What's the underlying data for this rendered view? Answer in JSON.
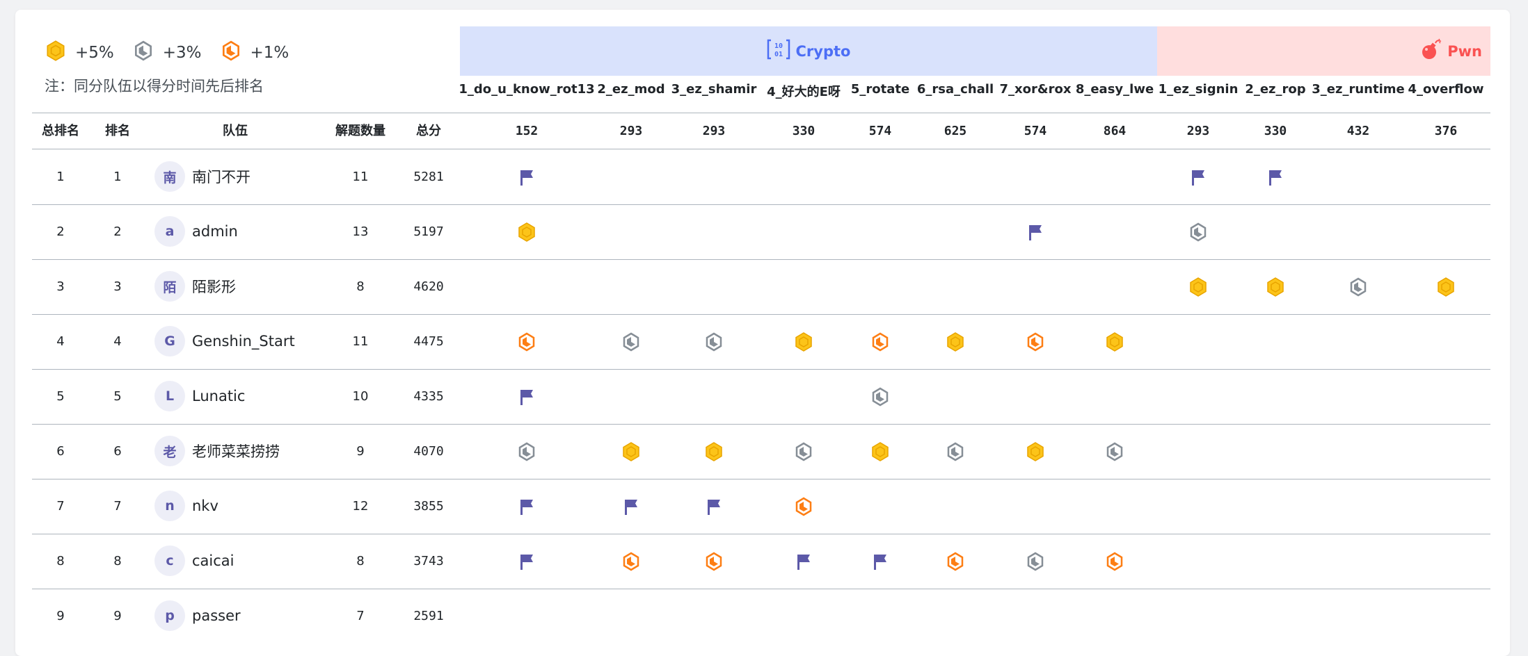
{
  "legend": [
    {
      "kind": "gold",
      "label": "+5%"
    },
    {
      "kind": "silver",
      "label": "+3%"
    },
    {
      "kind": "bronze",
      "label": "+1%"
    }
  ],
  "note": "注：同分队伍以得分时间先后排名",
  "categories": [
    {
      "name": "Crypto",
      "icon": "binary-icon",
      "color": "#4c6ef5",
      "bg": "#d9e2fc"
    },
    {
      "name": "Pwn",
      "icon": "bomb-icon",
      "color": "#fa5252",
      "bg": "#ffdede"
    }
  ],
  "columns": {
    "overall_rank": "总排名",
    "rank": "排名",
    "team": "队伍",
    "solved": "解题数量",
    "score": "总分"
  },
  "challenges": [
    {
      "name": "1_do_u_know_rot13",
      "score": "152"
    },
    {
      "name": "2_ez_mod",
      "score": "293"
    },
    {
      "name": "3_ez_shamir",
      "score": "293"
    },
    {
      "name": "4_好大的E呀",
      "score": "330"
    },
    {
      "name": "5_rotate",
      "score": "574"
    },
    {
      "name": "6_rsa_chall",
      "score": "625"
    },
    {
      "name": "7_xor&rox",
      "score": "574"
    },
    {
      "name": "8_easy_lwe",
      "score": "864"
    },
    {
      "name": "1_ez_signin",
      "score": "293"
    },
    {
      "name": "2_ez_rop",
      "score": "330"
    },
    {
      "name": "3_ez_runtime",
      "score": "432"
    },
    {
      "name": "4_overflow",
      "score": "376"
    }
  ],
  "rows": [
    {
      "overall": "1",
      "rank": "1",
      "avatar": "南",
      "team": "南门不开",
      "solved": "11",
      "score": "5281",
      "marks": [
        "flag",
        "",
        "",
        "",
        "",
        "",
        "",
        "",
        "flag",
        "flag",
        "",
        ""
      ]
    },
    {
      "overall": "2",
      "rank": "2",
      "avatar": "a",
      "team": "admin",
      "solved": "13",
      "score": "5197",
      "marks": [
        "gold",
        "",
        "",
        "",
        "",
        "",
        "flag",
        "",
        "silver",
        "",
        "",
        ""
      ]
    },
    {
      "overall": "3",
      "rank": "3",
      "avatar": "陌",
      "team": "陌影形",
      "solved": "8",
      "score": "4620",
      "marks": [
        "",
        "",
        "",
        "",
        "",
        "",
        "",
        "",
        "gold",
        "gold",
        "silver",
        "gold"
      ]
    },
    {
      "overall": "4",
      "rank": "4",
      "avatar": "G",
      "team": "Genshin_Start",
      "solved": "11",
      "score": "4475",
      "marks": [
        "bronze",
        "silver",
        "silver",
        "gold",
        "bronze",
        "gold",
        "bronze",
        "gold",
        "",
        "",
        "",
        ""
      ]
    },
    {
      "overall": "5",
      "rank": "5",
      "avatar": "L",
      "team": "Lunatic",
      "solved": "10",
      "score": "4335",
      "marks": [
        "flag",
        "",
        "",
        "",
        "silver",
        "",
        "",
        "",
        "",
        "",
        "",
        ""
      ]
    },
    {
      "overall": "6",
      "rank": "6",
      "avatar": "老",
      "team": "老师菜菜捞捞",
      "solved": "9",
      "score": "4070",
      "marks": [
        "silver",
        "gold",
        "gold",
        "silver",
        "gold",
        "silver",
        "gold",
        "silver",
        "",
        "",
        "",
        ""
      ]
    },
    {
      "overall": "7",
      "rank": "7",
      "avatar": "n",
      "team": "nkv",
      "solved": "12",
      "score": "3855",
      "marks": [
        "flag",
        "flag",
        "flag",
        "bronze",
        "",
        "",
        "",
        "",
        "",
        "",
        "",
        ""
      ]
    },
    {
      "overall": "8",
      "rank": "8",
      "avatar": "c",
      "team": "caicai",
      "solved": "8",
      "score": "3743",
      "marks": [
        "flag",
        "bronze",
        "bronze",
        "flag",
        "flag",
        "bronze",
        "silver",
        "bronze",
        "",
        "",
        "",
        ""
      ]
    },
    {
      "overall": "9",
      "rank": "9",
      "avatar": "p",
      "team": "passer",
      "solved": "7",
      "score": "2591",
      "marks": [
        "",
        "",
        "",
        "",
        "",
        "",
        "",
        "",
        "",
        "",
        "",
        ""
      ]
    }
  ],
  "colors": {
    "gold": "#fcc419",
    "gold_border": "#e8a400",
    "silver": "#adb5bd",
    "silver_dark": "#868e96",
    "bronze": "#fd7e14",
    "flag": "#5c59a8"
  }
}
